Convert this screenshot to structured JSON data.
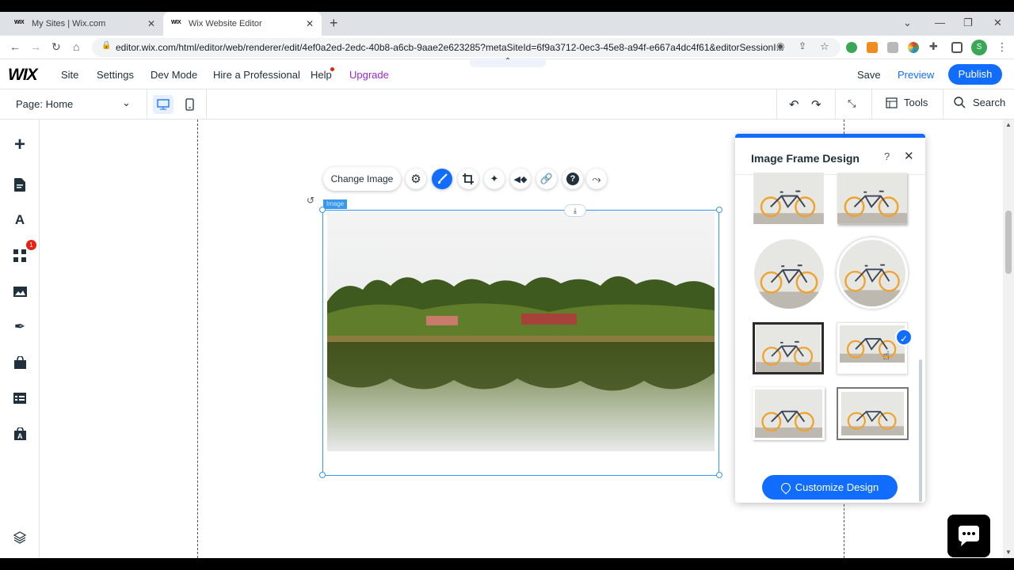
{
  "browser": {
    "tabs": [
      {
        "favicon": "WIX",
        "title": "My Sites | Wix.com"
      },
      {
        "favicon": "WIX",
        "title": "Wix Website Editor"
      }
    ],
    "url": "editor.wix.com/html/editor/web/renderer/edit/4ef0a2ed-2edc-40b8-a6cb-9aae2e623285?metaSiteId=6f9a3712-0ec3-45e8-a94f-e667a4dc4f61&editorSessionI...",
    "profile_initial": "S"
  },
  "topbar": {
    "logo": "WIX",
    "menu": [
      "Site",
      "Settings",
      "Dev Mode",
      "Hire a Professional",
      "Help",
      "Upgrade"
    ],
    "save": "Save",
    "preview": "Preview",
    "publish": "Publish"
  },
  "pagebar": {
    "page_label": "Page: Home",
    "tools": "Tools",
    "search": "Search"
  },
  "leftbar": {
    "badge": "1"
  },
  "element": {
    "label": "Image",
    "change_image": "Change Image"
  },
  "panel": {
    "title": "Image Frame Design",
    "help": "?",
    "customize": "Customize Design",
    "selected_option": 6
  },
  "colors": {
    "accent": "#116dff",
    "upgrade": "#9a27d5",
    "selection": "#3899ec",
    "notification": "#e62214"
  }
}
